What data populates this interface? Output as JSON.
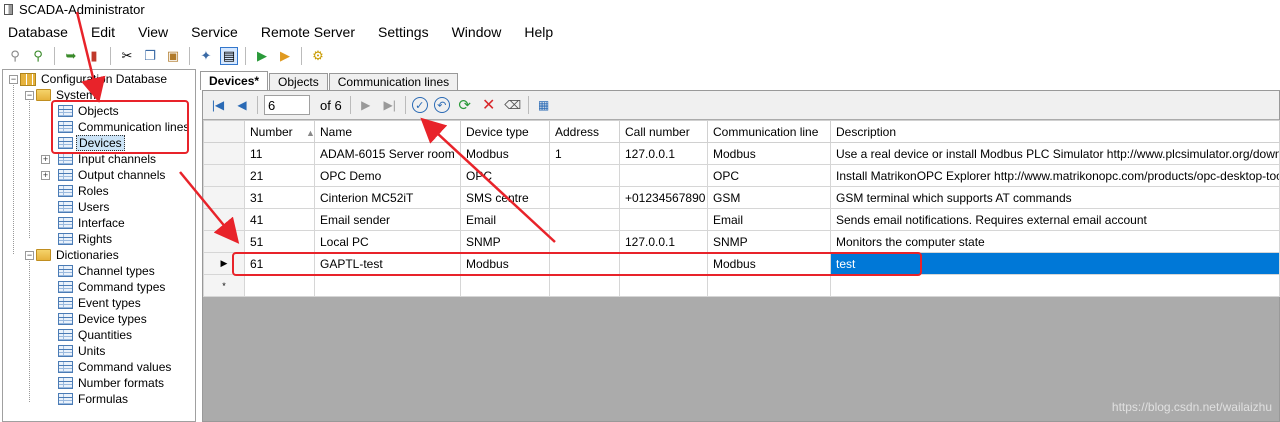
{
  "window": {
    "title": "SCADA-Administrator"
  },
  "menu": [
    "Database",
    "Edit",
    "View",
    "Service",
    "Remote Server",
    "Settings",
    "Window",
    "Help"
  ],
  "toolbar": {
    "icons": [
      "connect-icon",
      "disconnect-icon",
      "import-icon",
      "export-icon",
      "cut-icon",
      "copy-icon",
      "paste-icon",
      "clone-icon",
      "table-view-icon",
      "run-icon",
      "step-icon",
      "settings-icon"
    ]
  },
  "tree": {
    "root": "Configuration Database",
    "system": "System",
    "system_items": [
      "Objects",
      "Communication lines",
      "Devices",
      "Input channels",
      "Output channels",
      "Roles",
      "Users",
      "Interface",
      "Rights"
    ],
    "dictionaries": "Dictionaries",
    "dictionary_items": [
      "Channel types",
      "Command types",
      "Event types",
      "Device types",
      "Quantities",
      "Units",
      "Command values",
      "Number formats",
      "Formulas"
    ],
    "selected": "Devices"
  },
  "tabs": [
    "Devices*",
    "Objects",
    "Communication lines"
  ],
  "navigator": {
    "position": "6",
    "of_text": "of 6"
  },
  "grid": {
    "columns": [
      "Number",
      "Name",
      "Device type",
      "Address",
      "Call number",
      "Communication line",
      "Description"
    ],
    "sort_indicator": "▲",
    "rows": [
      {
        "number": "11",
        "name": "ADAM-6015 Server room",
        "device_type": "Modbus",
        "address": "1",
        "call_number": "127.0.0.1",
        "line": "Modbus",
        "description": "Use a real device or install Modbus PLC Simulator http://www.plcsimulator.org/downloads"
      },
      {
        "number": "21",
        "name": "OPC Demo",
        "device_type": "OPC",
        "address": "",
        "call_number": "",
        "line": "OPC",
        "description": "Install MatrikonOPC Explorer http://www.matrikonopc.com/products/opc-desktop-tools/"
      },
      {
        "number": "31",
        "name": "Cinterion MC52iT",
        "device_type": "SMS centre",
        "address": "",
        "call_number": "+01234567890",
        "line": "GSM",
        "description": "GSM terminal which supports AT commands"
      },
      {
        "number": "41",
        "name": "Email sender",
        "device_type": "Email",
        "address": "",
        "call_number": "",
        "line": "Email",
        "description": "Sends email notifications. Requires external email account"
      },
      {
        "number": "51",
        "name": "Local PC",
        "device_type": "SNMP",
        "address": "",
        "call_number": "127.0.0.1",
        "line": "SNMP",
        "description": "Monitors the computer state"
      },
      {
        "number": "61",
        "name": "GAPTL-test",
        "device_type": "Modbus",
        "address": "",
        "call_number": "",
        "line": "Modbus",
        "description": "test"
      }
    ],
    "current_marker": "▶",
    "new_row_marker": "*"
  },
  "watermark": "https://blog.csdn.net/wailaizhu",
  "colors": {
    "annotation": "#e8232a",
    "selection": "#0078d7"
  }
}
